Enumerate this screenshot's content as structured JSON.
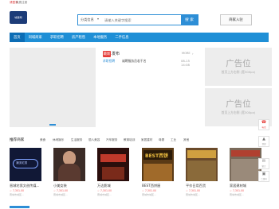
{
  "topbar": {
    "login": "请登录",
    "register": "免费注册"
  },
  "logo": {
    "text": "城镇网"
  },
  "search": {
    "type_label": "分类信息",
    "placeholder": "请输入关键字搜索",
    "button": "搜 索"
  },
  "join_button": "商家入驻",
  "nav": {
    "items": [
      "首页",
      "同城商家",
      "求职招聘",
      "房产租售",
      "本地服务",
      "二手信息"
    ]
  },
  "news": {
    "badge": "最新",
    "title": "发布",
    "more": "MORE",
    "rows": [
      {
        "tag": "求职招聘",
        "title": "诚聘服务员若干名",
        "date": "08-15 14:08"
      }
    ]
  },
  "ads": [
    {
      "big": "广告位",
      "small": "首页上方右侧 (宽300px)"
    },
    {
      "big": "广告位",
      "small": "首页上方右侧 (宽300px)"
    }
  ],
  "shops_bar": {
    "title": "推荐商家",
    "tabs": [
      "美食",
      "休闲娱乐",
      "生活服务",
      "丽人美容",
      "汽车服务",
      "教育培训",
      "家居建材",
      "母婴",
      "工业",
      "其他"
    ]
  },
  "shops": [
    {
      "name": "晋城宅男文创传媒...",
      "meta": "☆ 7,301.00",
      "addr": "晋城市城区..."
    },
    {
      "name": "小美女装",
      "meta": "☆ 7,301.00",
      "addr": "晋城市城区..."
    },
    {
      "name": "万达影城",
      "meta": "☆ 7,301.00",
      "addr": "晋城市城区..."
    },
    {
      "name": "BEST西饼屋",
      "meta": "☆ 7,301.00",
      "addr": "晋城市城区..."
    },
    {
      "name": "平价日用百货",
      "meta": "☆ 7,301.00",
      "addr": "晋城市城区..."
    },
    {
      "name": "家居建材城",
      "meta": "☆ 7,301.00",
      "addr": "晋城市城区..."
    }
  ],
  "shop_signs": [
    "潮流宅男",
    "西饼",
    "BEST西饼"
  ],
  "side": [
    {
      "icon": "☎",
      "label": "电话"
    },
    {
      "icon": "▲",
      "label": "顶部"
    },
    {
      "icon": "✉",
      "label": "留言"
    },
    {
      "icon": "▣",
      "label": "二维码"
    }
  ]
}
